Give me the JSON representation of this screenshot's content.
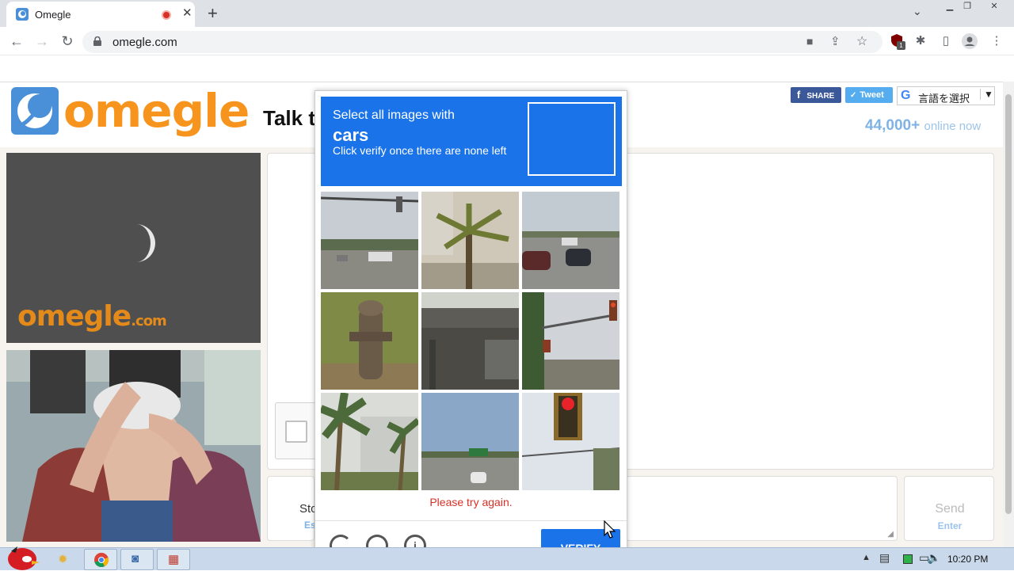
{
  "browser": {
    "tab_title": "Omegle",
    "url": "omegle.com",
    "new_tab_symbol": "+",
    "close_symbol": "✕",
    "extension_badge": "1"
  },
  "page": {
    "logo_text": "omegle",
    "tagline": "Talk t",
    "share_fb": "SHARE",
    "share_tw": "Tweet",
    "translate_label": "言語を選択",
    "online_count": "44,000+",
    "online_label": "online now",
    "video_watermark": "omegle",
    "video_watermark_suffix": ".com",
    "stop_label": "Sto",
    "stop_hint": "Es",
    "send_label": "Send",
    "send_hint": "Enter"
  },
  "captcha": {
    "instruction": "Select all images with",
    "target": "cars",
    "subtext": "Click verify once there are none left",
    "error": "Please try again.",
    "verify_label": "VERIFY",
    "tiles": [
      "traffic-lights-road",
      "palm-tree",
      "road-with-cars",
      "fire-hydrant",
      "overpass",
      "traffic-light-pole",
      "palm-trees",
      "highway",
      "red-traffic-light"
    ],
    "accent": "#1a73e8"
  },
  "taskbar": {
    "clock": "10:20 PM"
  }
}
